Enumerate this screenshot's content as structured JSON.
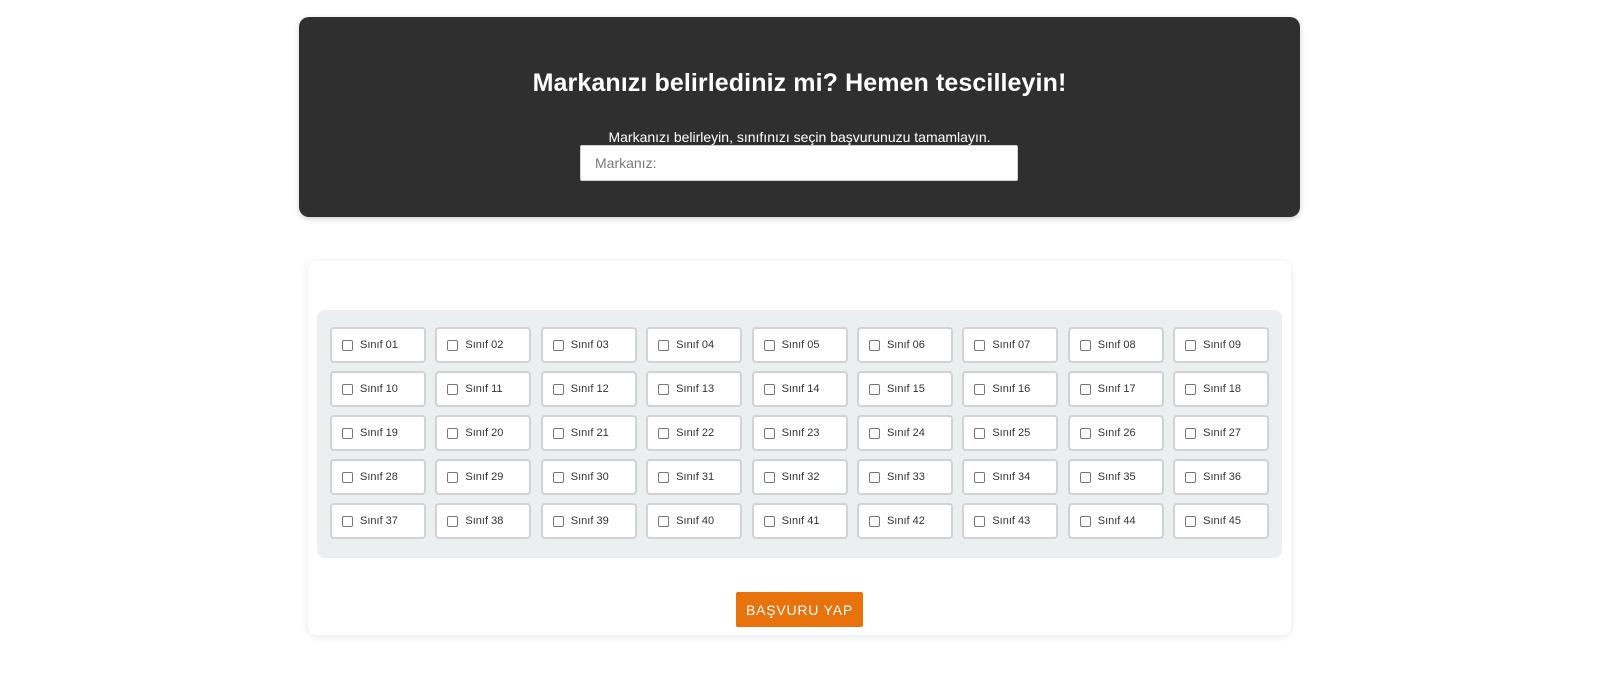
{
  "hero": {
    "title": "Markanızı belirlediniz mi? Hemen tescilleyin!",
    "subtitle": "Markanızı belirleyin, sınıfınızı seçin başvurunuzu tamamlayın.",
    "brand_input": {
      "placeholder": "Markanız:",
      "value": ""
    }
  },
  "classes": [
    "Sınıf 01",
    "Sınıf 02",
    "Sınıf 03",
    "Sınıf 04",
    "Sınıf 05",
    "Sınıf 06",
    "Sınıf 07",
    "Sınıf 08",
    "Sınıf 09",
    "Sınıf 10",
    "Sınıf 11",
    "Sınıf 12",
    "Sınıf 13",
    "Sınıf 14",
    "Sınıf 15",
    "Sınıf 16",
    "Sınıf 17",
    "Sınıf 18",
    "Sınıf 19",
    "Sınıf 20",
    "Sınıf 21",
    "Sınıf 22",
    "Sınıf 23",
    "Sınıf 24",
    "Sınıf 25",
    "Sınıf 26",
    "Sınıf 27",
    "Sınıf 28",
    "Sınıf 29",
    "Sınıf 30",
    "Sınıf 31",
    "Sınıf 32",
    "Sınıf 33",
    "Sınıf 34",
    "Sınıf 35",
    "Sınıf 36",
    "Sınıf 37",
    "Sınıf 38",
    "Sınıf 39",
    "Sınıf 40",
    "Sınıf 41",
    "Sınıf 42",
    "Sınıf 43",
    "Sınıf 44",
    "Sınıf 45"
  ],
  "submit_label": "BAŞVURU YAP",
  "colors": {
    "hero_background": "#2f2f2f",
    "panel_background": "#ecefef",
    "button_orange": "#e8720c"
  }
}
